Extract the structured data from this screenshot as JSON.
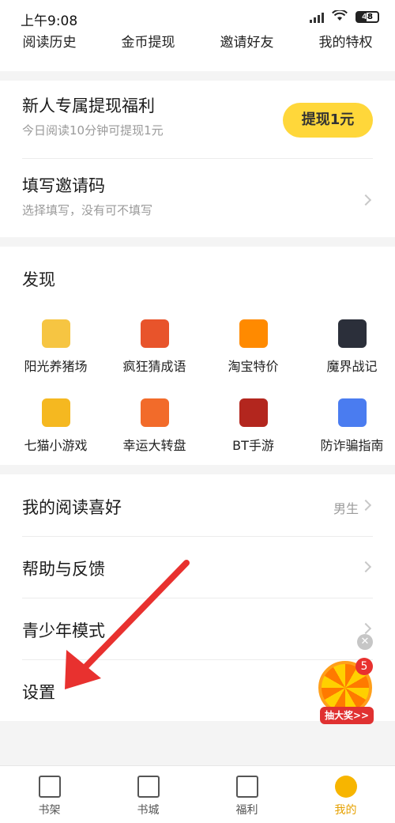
{
  "status_bar": {
    "time": "上午9:08",
    "battery": "48"
  },
  "top_nav": [
    "阅读历史",
    "金币提现",
    "邀请好友",
    "我的特权"
  ],
  "promo": {
    "title": "新人专属提现福利",
    "subtitle": "今日阅读10分钟可提现1元",
    "button": "提现1元"
  },
  "invite_code": {
    "title": "填写邀请码",
    "subtitle": "选择填写，没有可不填写"
  },
  "discover": {
    "title": "发现",
    "items": [
      {
        "label": "阳光养猪场",
        "icon": "pig-farm-icon",
        "color": "#f6c542"
      },
      {
        "label": "疯狂猜成语",
        "icon": "idiom-guess-icon",
        "color": "#e8542b"
      },
      {
        "label": "淘宝特价",
        "icon": "taobao-coupon-icon",
        "color": "#ff8a00"
      },
      {
        "label": "魔界战记",
        "icon": "demon-war-icon",
        "color": "#2b2f3a"
      },
      {
        "label": "七猫小游戏",
        "icon": "gamepad-icon",
        "color": "#f5b820"
      },
      {
        "label": "幸运大转盘",
        "icon": "lucky-wheel-icon",
        "color": "#f26b2a"
      },
      {
        "label": "BT手游",
        "icon": "bt-game-icon",
        "color": "#b3261e"
      },
      {
        "label": "防诈骗指南",
        "icon": "shield-yen-icon",
        "color": "#4a7cf0"
      }
    ]
  },
  "menu": {
    "reading_pref": {
      "label": "我的阅读喜好",
      "value": "男生"
    },
    "help": {
      "label": "帮助与反馈"
    },
    "youth_mode": {
      "label": "青少年模式"
    },
    "settings": {
      "label": "设置"
    }
  },
  "float_widget": {
    "badge": "5",
    "button": "抽大奖>>"
  },
  "tabs": [
    {
      "label": "书架",
      "icon": "bookshelf-icon"
    },
    {
      "label": "书城",
      "icon": "book-icon"
    },
    {
      "label": "福利",
      "icon": "gift-icon"
    },
    {
      "label": "我的",
      "icon": "profile-icon"
    }
  ],
  "colors": {
    "accent": "#ffd73a",
    "arrow": "#e8312f"
  }
}
